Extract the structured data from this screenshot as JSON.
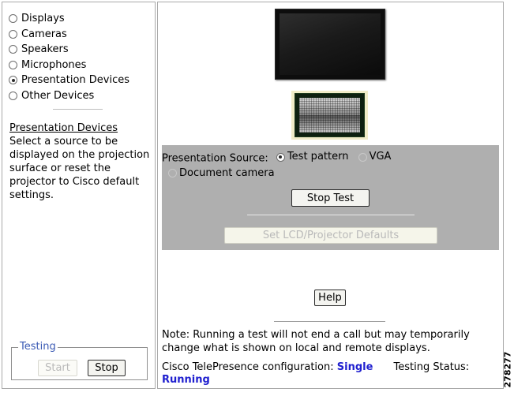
{
  "sidebar": {
    "devices": [
      {
        "label": "Displays",
        "checked": false
      },
      {
        "label": "Cameras",
        "checked": false
      },
      {
        "label": "Speakers",
        "checked": false
      },
      {
        "label": "Microphones",
        "checked": false
      },
      {
        "label": "Presentation Devices",
        "checked": true
      },
      {
        "label": "Other Devices",
        "checked": false
      }
    ],
    "help_title": "Presentation Devices",
    "help_body": "Select a source to be displayed on the projection surface or reset the projector to Cisco default settings."
  },
  "testing": {
    "legend": "Testing",
    "start_label": "Start",
    "stop_label": "Stop"
  },
  "main": {
    "presentation_source_label": "Presentation Source:",
    "sources": [
      {
        "label": "Test pattern",
        "checked": true,
        "enabled": true
      },
      {
        "label": "VGA",
        "checked": false,
        "enabled": true
      },
      {
        "label": "Document camera",
        "checked": false,
        "enabled": true
      }
    ],
    "stop_test_label": "Stop Test",
    "defaults_label": "Set LCD/Projector Defaults",
    "help_label": "Help",
    "note": "Note: Running a test will not end a call but may temporarily change what is shown on local and remote displays.",
    "config_label": "Cisco TelePresence configuration:",
    "config_value": "Single",
    "testing_status_label": "Testing Status:",
    "testing_status_value": "Running"
  },
  "figure_id": "278277"
}
